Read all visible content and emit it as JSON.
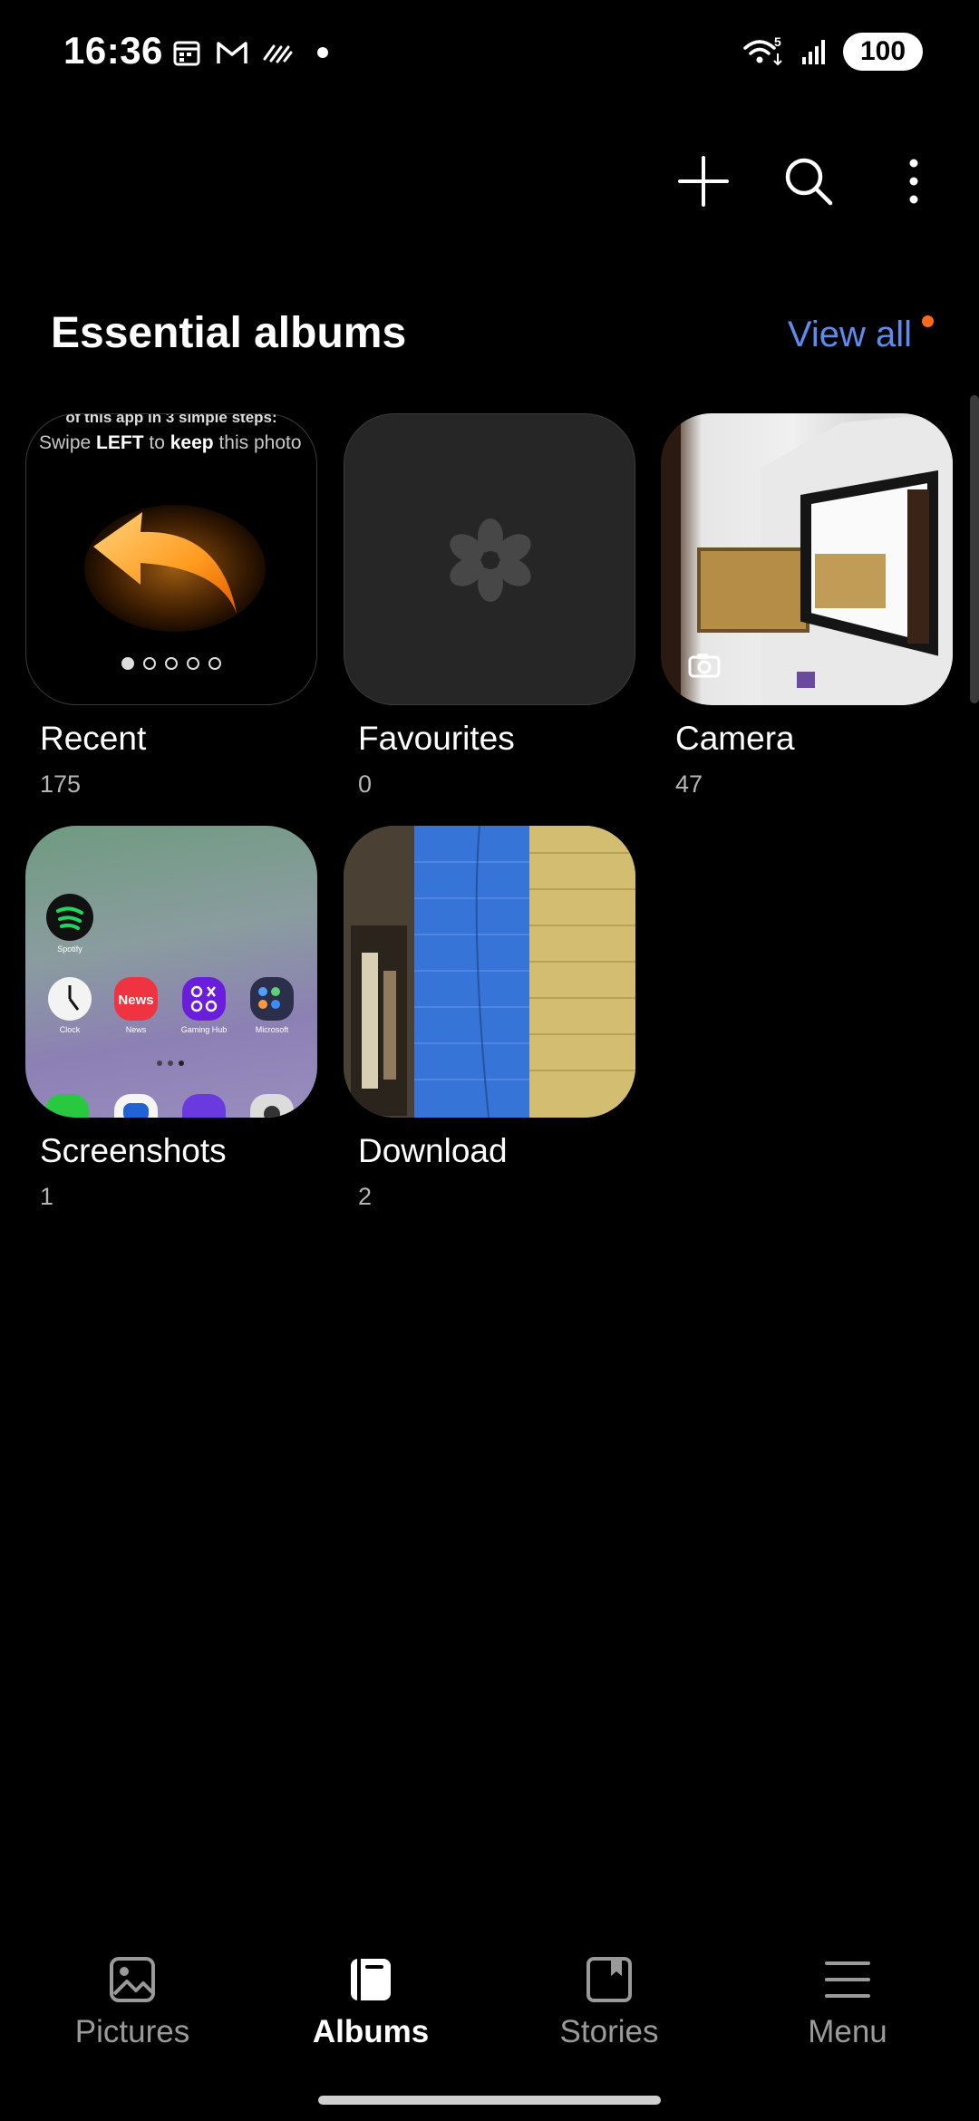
{
  "status_bar": {
    "time": "16:36",
    "battery": "100",
    "icons_left": [
      "calendar-icon",
      "gmail-icon",
      "signal-stripe-icon",
      "dot-icon"
    ],
    "icons_right": [
      "wifi-icon",
      "cell-signal-icon"
    ],
    "wifi_badge": "5"
  },
  "top_actions": [
    "add-icon",
    "search-icon",
    "more-icon"
  ],
  "section": {
    "title": "Essential albums",
    "view_all": "View all"
  },
  "albums": [
    {
      "name": "Recent",
      "count": "175",
      "hint_top": "of this app in 3 simple steps:",
      "hint_prefix": "Swipe",
      "hint_left": "LEFT",
      "hint_mid": "to",
      "hint_keep": "keep",
      "hint_suffix": "this photo"
    },
    {
      "name": "Favourites",
      "count": "0"
    },
    {
      "name": "Camera",
      "count": "47"
    },
    {
      "name": "Screenshots",
      "count": "1",
      "app_labels": [
        "Spotify",
        "Clock",
        "News",
        "Gaming Hub",
        "Microsoft"
      ],
      "news_tile": "News"
    },
    {
      "name": "Download",
      "count": "2"
    }
  ],
  "bottom_nav": [
    {
      "label": "Pictures",
      "icon": "pictures-icon",
      "active": false
    },
    {
      "label": "Albums",
      "icon": "albums-icon",
      "active": true
    },
    {
      "label": "Stories",
      "icon": "stories-icon",
      "active": false
    },
    {
      "label": "Menu",
      "icon": "menu-icon",
      "active": false
    }
  ],
  "colors": {
    "background": "#000000",
    "accent": "#5b8def",
    "notification_dot": "#ff6a1a"
  }
}
